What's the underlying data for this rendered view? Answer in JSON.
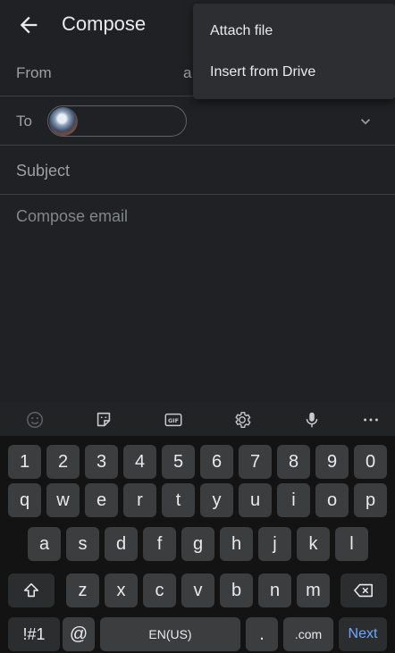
{
  "appbar": {
    "title": "Compose"
  },
  "fields": {
    "from_label": "From",
    "from_value_tail": "a",
    "to_label": "To",
    "subject_placeholder": "Subject",
    "body_placeholder": "Compose email"
  },
  "menu": {
    "items": [
      "Attach file",
      "Insert from Drive"
    ]
  },
  "keyboard": {
    "number_row": [
      "1",
      "2",
      "3",
      "4",
      "5",
      "6",
      "7",
      "8",
      "9",
      "0"
    ],
    "row1": [
      "q",
      "w",
      "e",
      "r",
      "t",
      "y",
      "u",
      "i",
      "o",
      "p"
    ],
    "row2": [
      "a",
      "s",
      "d",
      "f",
      "g",
      "h",
      "j",
      "k",
      "l"
    ],
    "row3": [
      "z",
      "x",
      "c",
      "v",
      "b",
      "n",
      "m"
    ],
    "symbols_key": "!#1",
    "at_key": "@",
    "space_label": "EN(US)",
    "period_key": ".",
    "dotcom_key": ".com",
    "action_key": "Next",
    "gif_label": "GIF"
  },
  "colors": {
    "accent": "#6aa8ff",
    "background": "#202124",
    "key": "#3c3d3f"
  }
}
